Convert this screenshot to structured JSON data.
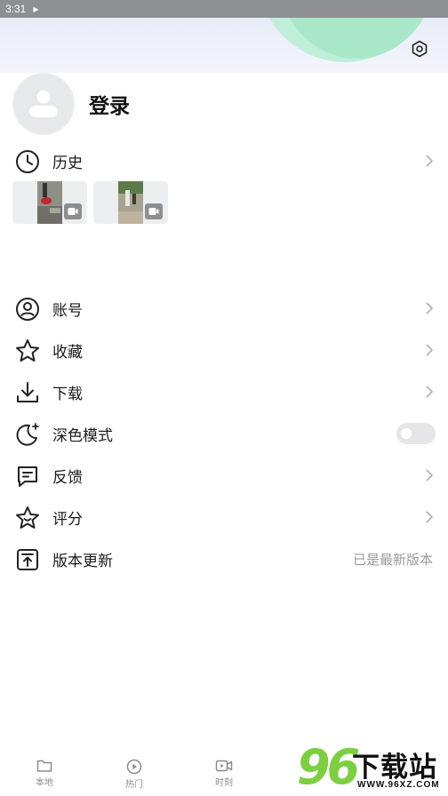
{
  "status_bar": {
    "time": "3:31"
  },
  "profile": {
    "login_label": "登录"
  },
  "history": {
    "label": "历史"
  },
  "menu": {
    "account": "账号",
    "favorites": "收藏",
    "downloads": "下载",
    "dark_mode": "深色模式",
    "feedback": "反馈",
    "rating": "评分",
    "update": "版本更新",
    "update_status": "已是最新版本"
  },
  "dark_mode_enabled": false,
  "bottom_nav": {
    "local": "本地",
    "hot": "热门",
    "moments": "时刻"
  },
  "watermark": {
    "logo": "96",
    "text": "下载站",
    "url": "WWW.96XZ.COM"
  },
  "colors": {
    "accent_green": "#a8e8c8",
    "watermark_green": "#7ccf3f"
  }
}
